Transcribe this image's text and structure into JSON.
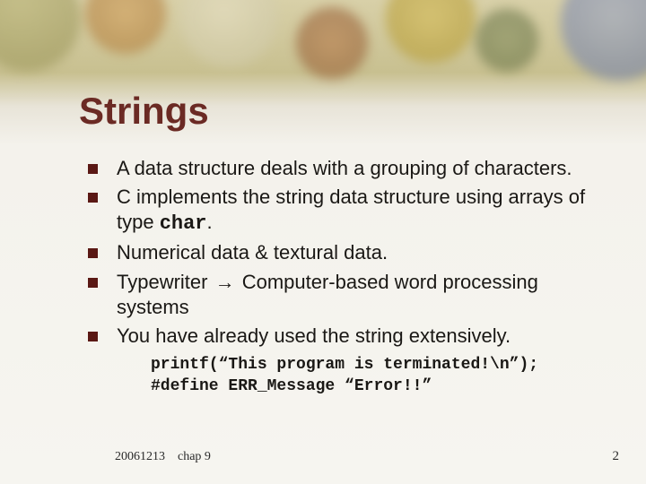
{
  "title": "Strings",
  "bullets": {
    "b1": "A data structure deals with a grouping of characters.",
    "b2_a": "C implements the ",
    "b2_b": "string",
    "b2_c": " data structure using arrays of type ",
    "b2_d": "char",
    "b2_e": ".",
    "b3_a": "Numerical data & ",
    "b3_b": "textural",
    "b3_c": " data.",
    "b4_a": "Typewriter ",
    "b4_arrow": "→",
    "b4_b": " Computer-based word processing systems",
    "b5": "You have already used the string extensively."
  },
  "code": {
    "line1": "printf(“This program is terminated!\\n”);",
    "line2": "#define ERR_Message “Error!!”"
  },
  "footer": {
    "date": "20061213",
    "chapter": "chap 9"
  },
  "page_number": "2"
}
